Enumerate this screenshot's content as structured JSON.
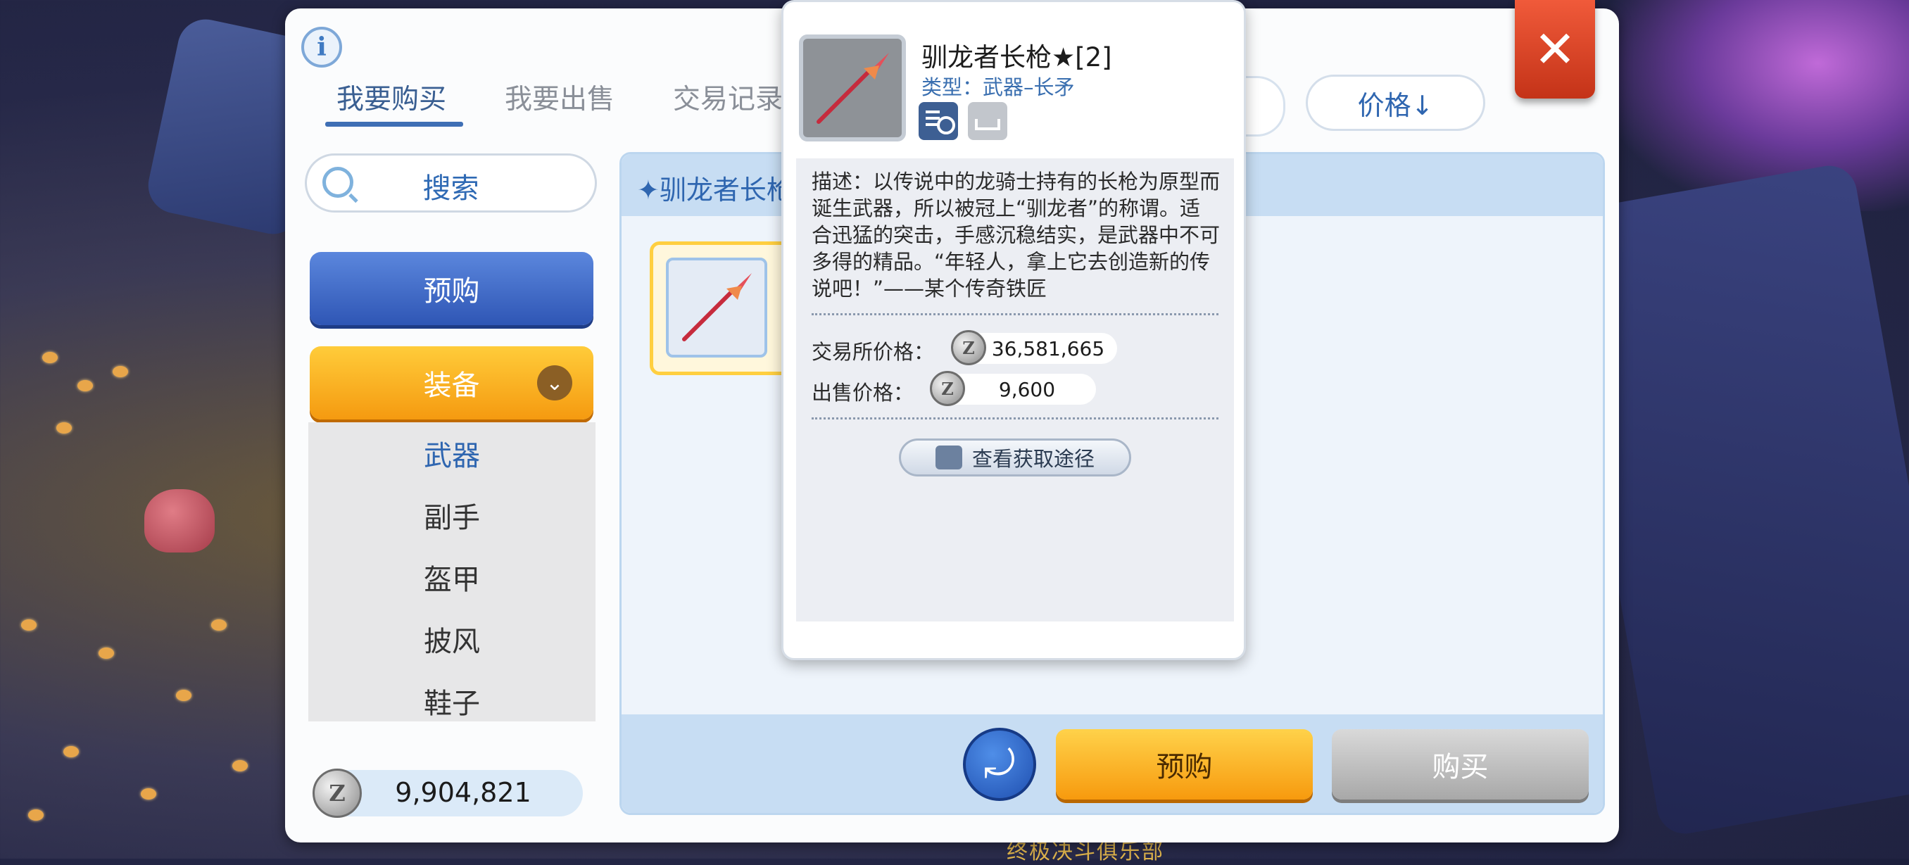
{
  "background": {
    "footer_text": "终极决斗俱乐部"
  },
  "tabs": [
    {
      "label": "我要购买",
      "active": true
    },
    {
      "label": "我要出售",
      "active": false
    },
    {
      "label": "交易记录",
      "active": false
    }
  ],
  "sort": {
    "label": "价格↓"
  },
  "sidebar": {
    "search_label": "搜索",
    "prebuy_label": "预购",
    "category_label": "装备",
    "subcategories": [
      {
        "label": "武器",
        "active": true
      },
      {
        "label": "副手",
        "active": false
      },
      {
        "label": "盔甲",
        "active": false
      },
      {
        "label": "披风",
        "active": false
      },
      {
        "label": "鞋子",
        "active": false
      }
    ],
    "balance": "9,904,821",
    "zeny_symbol": "Z"
  },
  "content": {
    "title": "✦驯龙者长枪"
  },
  "item_popup": {
    "name": "驯龙者长枪★[2]",
    "type_label": "类型：",
    "type_value": "武器–长矛",
    "description": "描述：以传说中的龙骑士持有的长枪为原型而诞生武器，所以被冠上“驯龙者”的称谓。适合迅猛的突击，手感沉稳结实，是武器中不可多得的精品。“年轻人，拿上它去创造新的传说吧！”——某个传奇铁匠",
    "exchange_price_label": "交易所价格：",
    "exchange_price": "36,581,665",
    "sell_price_label": "出售价格：",
    "sell_price": "9,600",
    "source_button": "查看获取途径"
  },
  "footer_buttons": {
    "prebuy": "预购",
    "buy": "购买"
  },
  "icons": {
    "info": "info-icon",
    "close": "close-icon",
    "search": "search-icon",
    "chevron": "chevron-down-icon",
    "back": "back-arrow-icon",
    "zeny": "zeny-coin-icon",
    "spear": "spear-icon",
    "details": "item-details-icon",
    "tray": "tray-icon"
  },
  "colors": {
    "accent_blue": "#2f66b0",
    "orange_button": "#f79a0e",
    "close_red": "#d8401f"
  }
}
